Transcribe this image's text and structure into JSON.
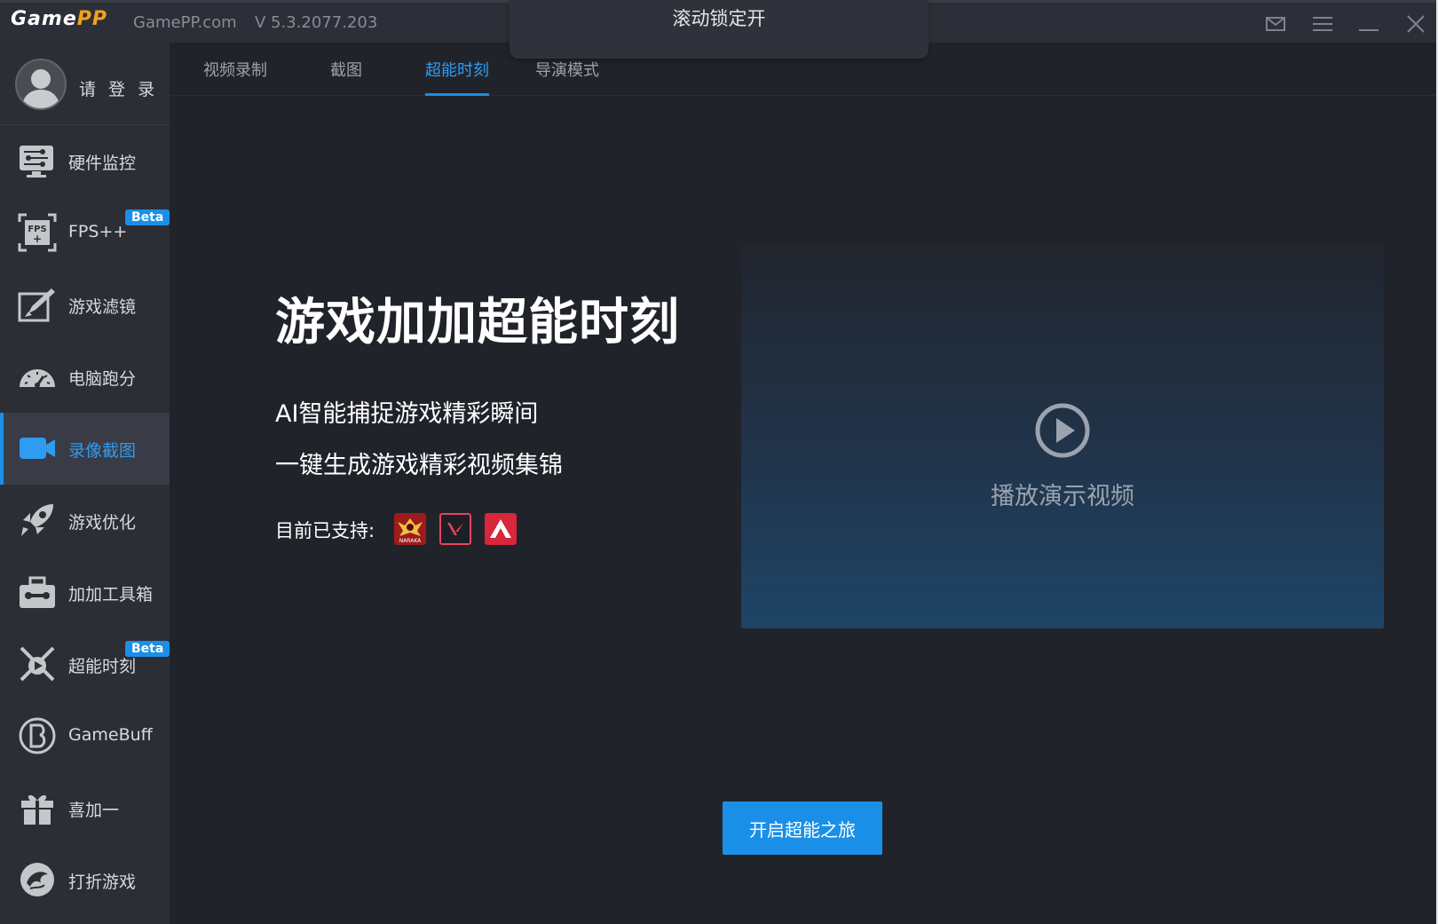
{
  "titlebar": {
    "brand_main": "Game",
    "brand_accent": "PP",
    "site": "GamePP.com",
    "version": "V 5.3.2077.203"
  },
  "toast": {
    "text": "滚动锁定开"
  },
  "user": {
    "login_label": "请 登 录"
  },
  "sidebar": {
    "items": [
      {
        "label": "硬件监控",
        "icon": "hardware-monitor-icon"
      },
      {
        "label": "FPS++",
        "icon": "fps-icon",
        "badge": "Beta"
      },
      {
        "label": "游戏滤镜",
        "icon": "game-filter-icon"
      },
      {
        "label": "电脑跑分",
        "icon": "benchmark-gauge-icon"
      },
      {
        "label": "录像截图",
        "icon": "camera-icon",
        "active": true
      },
      {
        "label": "游戏优化",
        "icon": "rocket-icon"
      },
      {
        "label": "加加工具箱",
        "icon": "toolbox-icon"
      },
      {
        "label": "超能时刻",
        "icon": "swords-icon",
        "badge": "Beta"
      },
      {
        "label": "GameBuff",
        "icon": "gamebuff-icon"
      },
      {
        "label": "喜加一",
        "icon": "gift-icon"
      },
      {
        "label": "打折游戏",
        "icon": "phoenix-icon"
      }
    ]
  },
  "tabs": [
    {
      "label": "视频录制"
    },
    {
      "label": "截图"
    },
    {
      "label": "超能时刻",
      "active": true
    },
    {
      "label": "导演模式"
    }
  ],
  "main": {
    "title": "游戏加加超能时刻",
    "line1": "AI智能捕捉游戏精彩瞬间",
    "line2": "一键生成游戏精彩视频集锦",
    "support_label": "目前已支持:",
    "supported_games": [
      {
        "icon": "naraka-icon",
        "caption": "NARAKA"
      },
      {
        "icon": "valorant-icon"
      },
      {
        "icon": "apex-icon"
      }
    ],
    "video_label": "播放演示视频",
    "cta_label": "开启超能之旅"
  },
  "colors": {
    "accent": "#1a8fe8",
    "background": "#21232b",
    "sidebar": "#2c2e36",
    "titlebar": "#2c2f37",
    "brand_accent": "#f2a21a"
  }
}
